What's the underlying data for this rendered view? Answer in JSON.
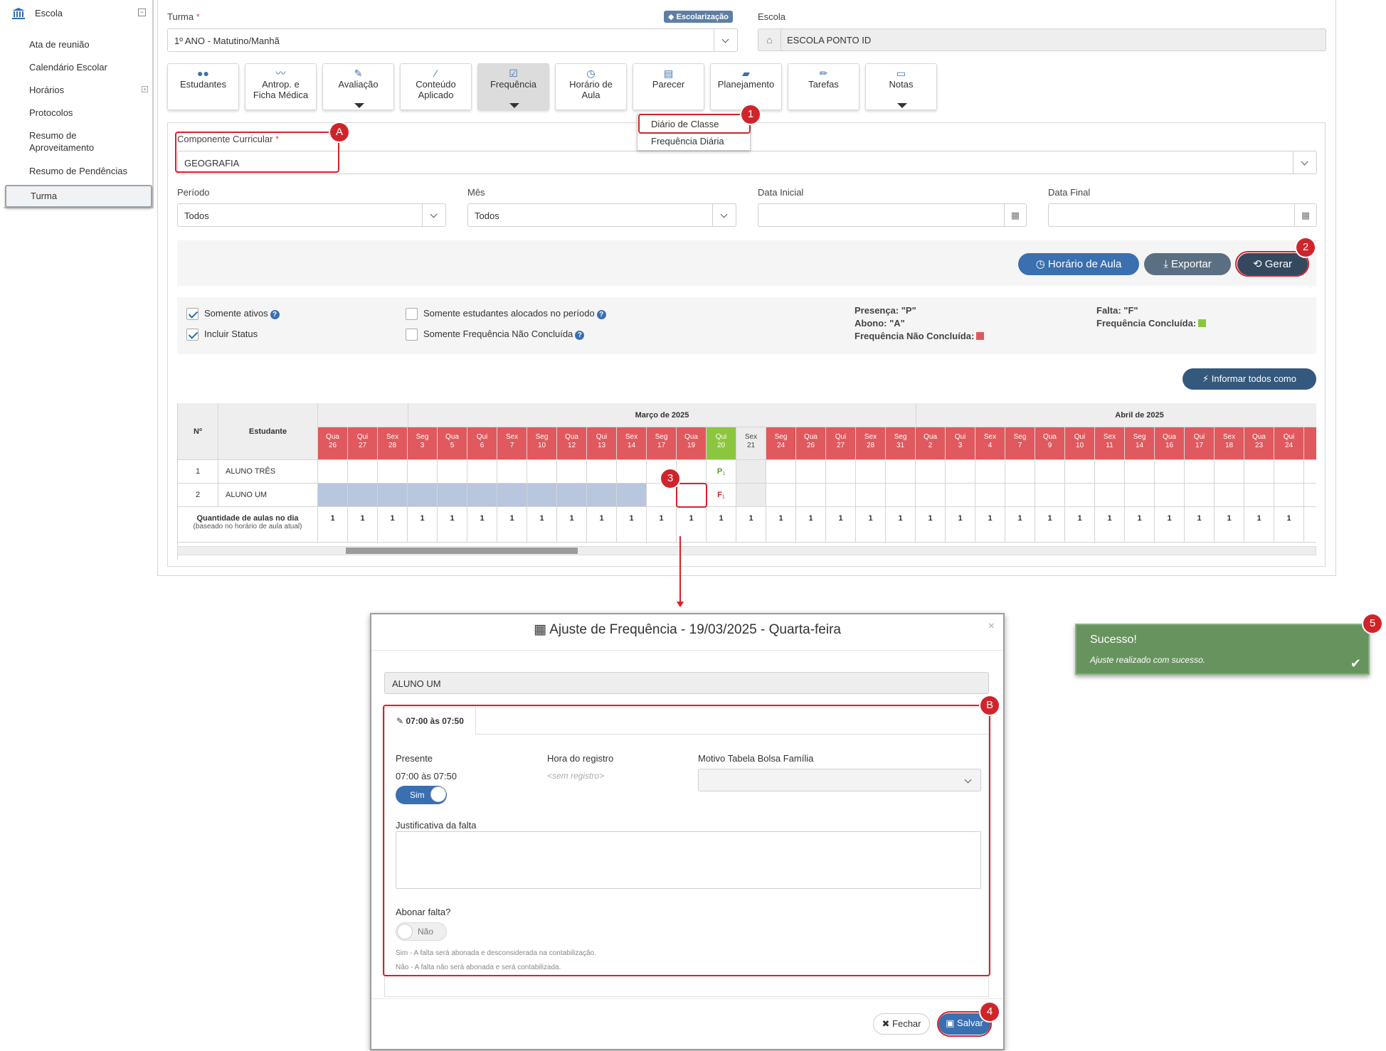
{
  "sidebar": {
    "title": "Escola",
    "items": [
      "Ata de reunião",
      "Calendário Escolar",
      "Horários",
      "Protocolos",
      "Resumo de",
      "Aproveitamento",
      "Resumo de Pendências"
    ],
    "active": "Turma"
  },
  "header": {
    "turma_label": "Turma",
    "turma_value": "1º ANO - Matutino/Manhã",
    "badge": "Escolarização",
    "escola_label": "Escola",
    "escola_value": "ESCOLA PONTO ID"
  },
  "tiles": [
    {
      "l1": "Estudantes",
      "l2": ""
    },
    {
      "l1": "Antrop. e",
      "l2": "Ficha Médica"
    },
    {
      "l1": "Avaliação",
      "l2": ""
    },
    {
      "l1": "Conteúdo",
      "l2": "Aplicado"
    },
    {
      "l1": "Frequência",
      "l2": ""
    },
    {
      "l1": "Horário de",
      "l2": "Aula"
    },
    {
      "l1": "Parecer",
      "l2": ""
    },
    {
      "l1": "Planejamento",
      "l2": ""
    },
    {
      "l1": "Tarefas",
      "l2": ""
    },
    {
      "l1": "Notas",
      "l2": ""
    }
  ],
  "dropdown": [
    "Diário de Classe",
    "Frequência Diária"
  ],
  "filters": {
    "componente_label": "Componente Curricular",
    "componente_value": "GEOGRAFIA",
    "periodo_label": "Período",
    "periodo_value": "Todos",
    "mes_label": "Mês",
    "mes_value": "Todos",
    "data_inicial_label": "Data Inicial",
    "data_final_label": "Data Final"
  },
  "actions": {
    "horario": "Horário de Aula",
    "exportar": "Exportar",
    "gerar": "Gerar",
    "informar": "Informar todos como presentes"
  },
  "options": {
    "somente_ativos": "Somente ativos",
    "incluir_status": "Incluir Status",
    "alocados": "Somente estudantes alocados no período",
    "nao_concluida": "Somente Frequência Não Concluída"
  },
  "legend": {
    "presenca": "Presença: \"P\"",
    "abono": "Abono: \"A\"",
    "nao_concluida": "Frequência Não Concluída:",
    "falta": "Falta: \"F\"",
    "concluida": "Frequência Concluída:",
    "red": "#e0595e",
    "green": "#8cc63f"
  },
  "table": {
    "col_num": "Nº",
    "col_estudante": "Estudante",
    "month1": "Março de 2025",
    "month2": "Abril de 2025",
    "days": [
      [
        "Qua",
        "26"
      ],
      [
        "Qui",
        "27"
      ],
      [
        "Sex",
        "28"
      ],
      [
        "Seg",
        "3"
      ],
      [
        "Qua",
        "5"
      ],
      [
        "Qui",
        "6"
      ],
      [
        "Sex",
        "7"
      ],
      [
        "Seg",
        "10"
      ],
      [
        "Qua",
        "12"
      ],
      [
        "Qui",
        "13"
      ],
      [
        "Sex",
        "14"
      ],
      [
        "Seg",
        "17"
      ],
      [
        "Qua",
        "19"
      ],
      [
        "Qui",
        "20"
      ],
      [
        "Sex",
        "21"
      ],
      [
        "Seg",
        "24"
      ],
      [
        "Qua",
        "26"
      ],
      [
        "Qui",
        "27"
      ],
      [
        "Sex",
        "28"
      ],
      [
        "Seg",
        "31"
      ],
      [
        "Qua",
        "2"
      ],
      [
        "Qui",
        "3"
      ],
      [
        "Sex",
        "4"
      ],
      [
        "Seg",
        "7"
      ],
      [
        "Qua",
        "9"
      ],
      [
        "Qui",
        "10"
      ],
      [
        "Sex",
        "11"
      ],
      [
        "Seg",
        "14"
      ],
      [
        "Qua",
        "16"
      ],
      [
        "Qui",
        "17"
      ],
      [
        "Sex",
        "18"
      ],
      [
        "Qua",
        "23"
      ],
      [
        "Qui",
        "24"
      ],
      [
        "S",
        ""
      ]
    ],
    "rows": [
      {
        "num": "1",
        "name": "ALUNO TRÊS",
        "mark": "P"
      },
      {
        "num": "2",
        "name": "ALUNO UM",
        "mark": "F"
      }
    ],
    "mark_sub": "1",
    "qty_label": "Quantidade de aulas no dia",
    "qty_sub": "(baseado no horário de aula atual)",
    "qty_value": "1"
  },
  "modal": {
    "title": "Ajuste de Frequência - 19/03/2025 - Quarta-feira",
    "student": "ALUNO UM",
    "tab": "07:00 às 07:50",
    "presente_label": "Presente",
    "presente_time": "07:00 às 07:50",
    "sim": "Sim",
    "hora_label": "Hora do registro",
    "hora_value": "<sem registro>",
    "motivo_label": "Motivo Tabela Bolsa Família",
    "justificativa_label": "Justificativa da falta",
    "abonar_label": "Abonar falta?",
    "nao": "Não",
    "help1": "Sim - A falta será abonada e desconsiderada na contabilização.",
    "help2": "Não - A falta não será abonada e será contabilizada.",
    "fechar": "Fechar",
    "salvar": "Salvar"
  },
  "toast": {
    "title": "Sucesso!",
    "message": "Ajuste realizado com sucesso."
  },
  "markers": [
    "1",
    "2",
    "3",
    "4",
    "5",
    "A",
    "B"
  ]
}
